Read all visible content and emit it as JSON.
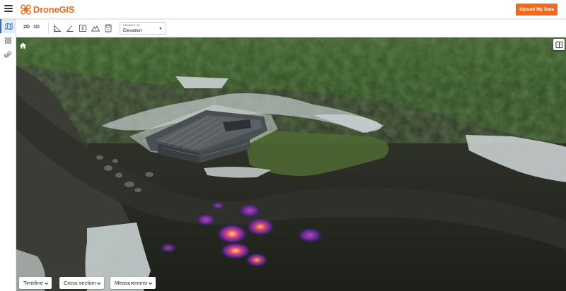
{
  "app": {
    "name": "DroneGIS",
    "brand_color": "#f06a1a",
    "accent_color": "#2f6bb3"
  },
  "header": {
    "upload_label": "Upload My Data"
  },
  "rail": {
    "items": [
      {
        "icon": "map-icon",
        "active": true
      },
      {
        "icon": "grid-pattern-icon",
        "active": false
      },
      {
        "icon": "paperclip-icon",
        "active": false
      }
    ]
  },
  "toolbar": {
    "mode_2d": "2D",
    "mode_3d": "3D",
    "active_mode": "3D",
    "tools": [
      "area-icon",
      "angle-icon",
      "volume-icon",
      "profile-icon",
      "calculator-icon"
    ],
    "measure": {
      "label": "Measure on",
      "value": "Elevation"
    }
  },
  "viewport": {
    "home_icon": "home-icon",
    "view_toggle_icon": "split-view-icon"
  },
  "bottom_bar": {
    "timeline": "Timeline",
    "cross_section": "Cross section",
    "measurement": "Measurement"
  }
}
